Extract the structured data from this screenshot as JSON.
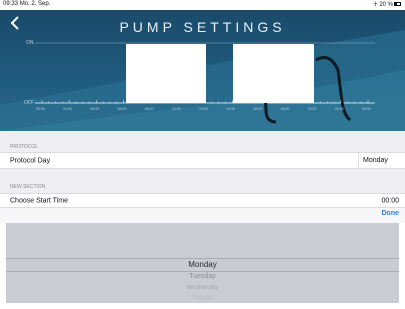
{
  "status": {
    "time": "09:33",
    "date": "Mo. 2. Sep.",
    "signal": "☥ 20 %"
  },
  "header": {
    "title": "PUMP SETTINGS",
    "back_icon": "chevron-left-icon"
  },
  "chart": {
    "y_on": "ON",
    "y_off": "OFF",
    "ticks": [
      "00:00",
      "02:00",
      "04:00",
      "06:00",
      "08:00",
      "10:00",
      "12:00",
      "14:00",
      "16:00",
      "18:00",
      "20:00",
      "22:00",
      "00:00"
    ]
  },
  "sections": {
    "protocol": {
      "header": "PROTOCOL",
      "row_label": "Protocol Day",
      "row_value": "Monday"
    },
    "new_section": {
      "header": "NEW SECTION",
      "row_label": "Choose Start Time",
      "row_value": "00:00"
    }
  },
  "picker": {
    "done_label": "Done",
    "selected": "Monday",
    "options_below": [
      "Tuesday",
      "Wednesday",
      "Thursday"
    ]
  }
}
